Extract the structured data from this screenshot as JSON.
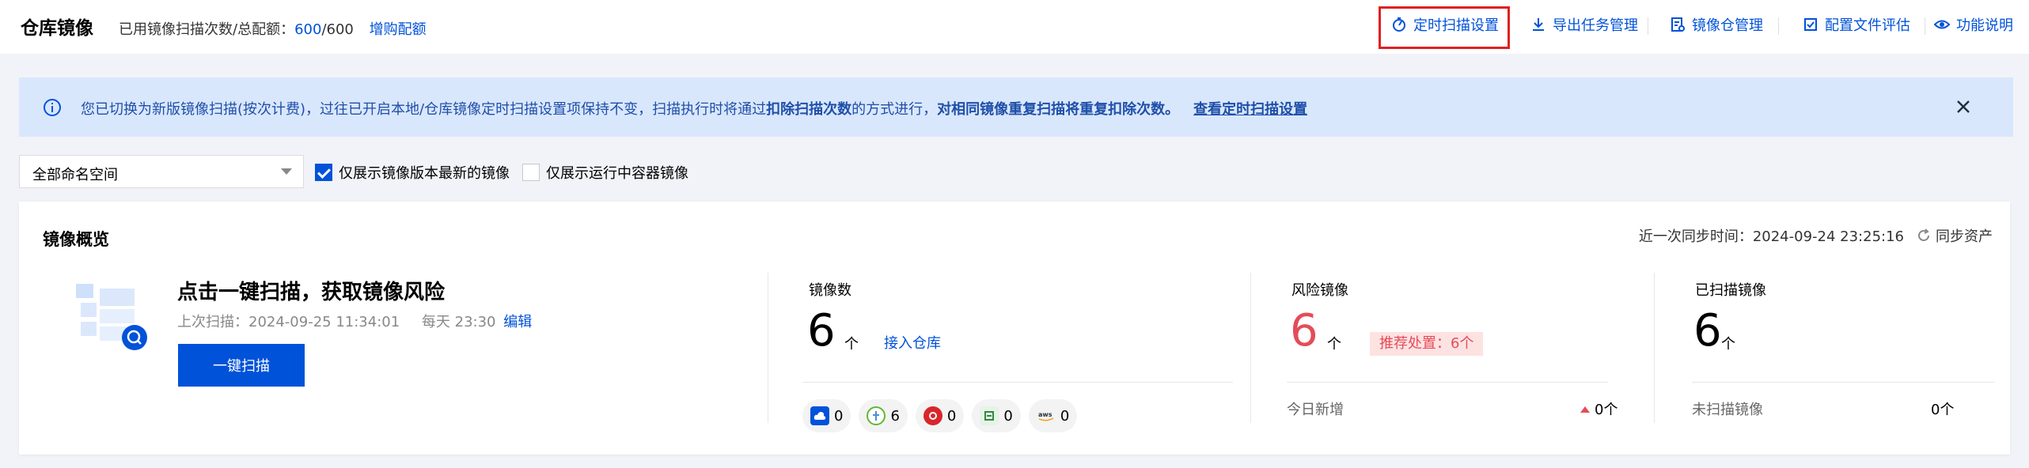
{
  "header": {
    "title": "仓库镜像",
    "quota_label": "已用镜像扫描次数/总配额：",
    "quota_used": "600",
    "quota_total": "/600",
    "buy_quota": "增购配额",
    "actions": {
      "scheduled_scan": "定时扫描设置",
      "export_tasks": "导出任务管理",
      "registry_manage": "镜像仓管理",
      "config_eval": "配置文件评估",
      "help": "功能说明"
    }
  },
  "notice": {
    "text_part1": "您已切换为新版镜像扫描(按次计费)，过往已开启本地/仓库镜像定时扫描设置项保持不变，扫描执行时将通过",
    "text_bold1": "扣除扫描次数",
    "text_part2": "的方式进行，",
    "text_bold2": "对相同镜像重复扫描将重复扣除次数。",
    "link": "查看定时扫描设置"
  },
  "filters": {
    "namespace": "全部命名空间",
    "latest_only": "仅展示镜像版本最新的镜像",
    "running_only": "仅展示运行中容器镜像",
    "latest_only_checked": true,
    "running_only_checked": false
  },
  "overview": {
    "title": "镜像概览",
    "sync_time": "近一次同步时间：2024-09-24 23:25:16",
    "sync_button": "同步资产",
    "scan": {
      "title": "点击一键扫描，获取镜像风险",
      "last_scan": "上次扫描：2024-09-25 11:34:01",
      "daily": "每天 23:30",
      "edit": "编辑",
      "button": "一键扫描"
    },
    "image_count": {
      "label": "镜像数",
      "value": "6",
      "unit": "个",
      "link": "接入仓库"
    },
    "registries": [
      {
        "icon": "tencent-cloud-icon",
        "count": "0",
        "color": "#0052d9"
      },
      {
        "icon": "harbor-icon",
        "count": "6",
        "color": "#60b932"
      },
      {
        "icon": "jfrog-icon",
        "count": "0",
        "color": "#d8262c"
      },
      {
        "icon": "alibaba-cloud-icon",
        "count": "0",
        "color": "#2e8b3a"
      },
      {
        "icon": "aws-icon",
        "count": "0",
        "color": "#232f3e"
      }
    ],
    "risk": {
      "label": "风险镜像",
      "value": "6",
      "unit": "个",
      "badge": "推荐处置：6个",
      "new_today_label": "今日新增",
      "new_today_value": "0个"
    },
    "scanned": {
      "label": "已扫描镜像",
      "value": "6",
      "unit": "个",
      "unscanned_label": "未扫描镜像",
      "unscanned_value": "0个"
    }
  },
  "colors": {
    "primary": "#0052d9",
    "danger": "#e34d59",
    "notice_bg": "#d9e7fd",
    "highlight_box": "#e02020"
  }
}
